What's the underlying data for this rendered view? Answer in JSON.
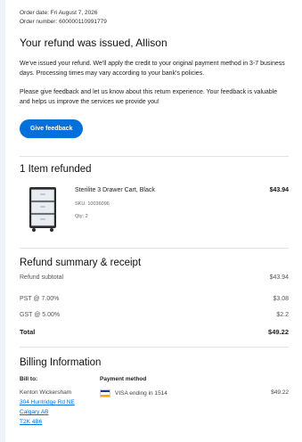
{
  "header": {
    "order_date": "Order date: Fri August 7, 2026",
    "order_number": "Order number: 600000110991779"
  },
  "main": {
    "title": "Your refund was issued, Allison",
    "para1": "We've issued your refund. We'll apply the credit to your original payment method in 3-7 business days. Processing times may vary according to your bank's policies.",
    "para2": "Please give feedback and let us know about this return experience. Your feedback is valuable and helps us improve the services we provide you!",
    "feedback_button": "Give feedback"
  },
  "items_section": {
    "title": "1 Item refunded",
    "items": [
      {
        "name": "Sterilite 3 Drawer Cart, Black",
        "price": "$43.94",
        "sku": "SKU: 10036096",
        "qty": "Qty: 2",
        "icon": "drawer-cart-thumbnail"
      }
    ]
  },
  "summary": {
    "title": "Refund summary & receipt",
    "rows": [
      {
        "label": "Refund subtotal",
        "value": "$43.94"
      },
      {
        "label": "PST @ 7.00%",
        "value": "$3.08"
      },
      {
        "label": "GST @ 5.00%",
        "value": "$2.2"
      }
    ],
    "total_label": "Total",
    "total_value": "$49.22"
  },
  "billing": {
    "title": "Billing Information",
    "bill_to_label": "Bill to:",
    "name": "Kenton Wickersham",
    "address1": "304 Huntridge Rd NE",
    "address2": "Calgary AB",
    "postal": "T2K 4B6",
    "payment_label": "Payment method",
    "card_text": "VISA ending in 1514",
    "card_amount": "$49.22",
    "card_icon": "visa-card-icon"
  },
  "colors": {
    "accent": "#0071dc",
    "divider": "#e3e3e3"
  }
}
